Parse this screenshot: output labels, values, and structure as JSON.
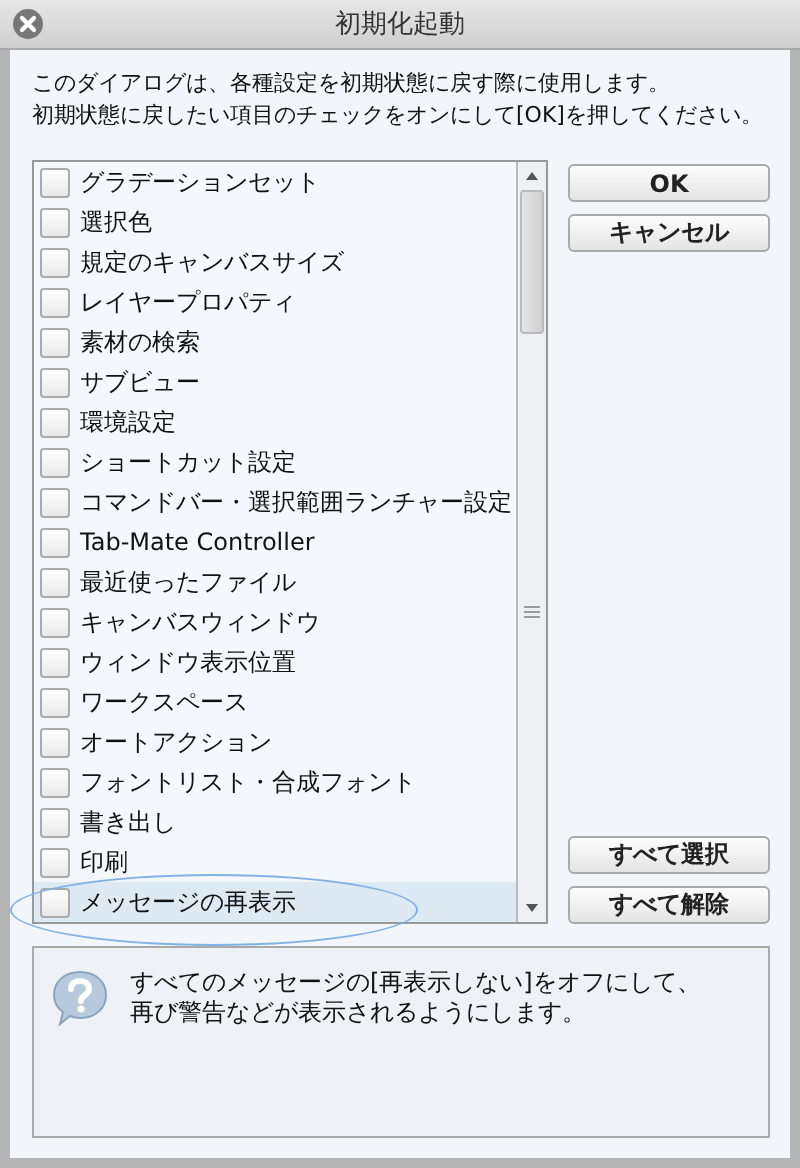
{
  "window": {
    "title": "初期化起動"
  },
  "description": [
    "このダイアログは、各種設定を初期状態に戻す際に使用します。",
    "初期状態に戻したい項目のチェックをオンにして[OK]を押してください。"
  ],
  "items": [
    {
      "label": "グラデーションセット",
      "checked": false,
      "selected": false
    },
    {
      "label": "選択色",
      "checked": false,
      "selected": false
    },
    {
      "label": "規定のキャンバスサイズ",
      "checked": false,
      "selected": false
    },
    {
      "label": "レイヤープロパティ",
      "checked": false,
      "selected": false
    },
    {
      "label": "素材の検索",
      "checked": false,
      "selected": false
    },
    {
      "label": "サブビュー",
      "checked": false,
      "selected": false
    },
    {
      "label": "環境設定",
      "checked": false,
      "selected": false
    },
    {
      "label": "ショートカット設定",
      "checked": false,
      "selected": false
    },
    {
      "label": "コマンドバー・選択範囲ランチャー設定",
      "checked": false,
      "selected": false
    },
    {
      "label": "Tab-Mate Controller",
      "checked": false,
      "selected": false
    },
    {
      "label": "最近使ったファイル",
      "checked": false,
      "selected": false
    },
    {
      "label": "キャンバスウィンドウ",
      "checked": false,
      "selected": false
    },
    {
      "label": "ウィンドウ表示位置",
      "checked": false,
      "selected": false
    },
    {
      "label": "ワークスペース",
      "checked": false,
      "selected": false
    },
    {
      "label": "オートアクション",
      "checked": false,
      "selected": false
    },
    {
      "label": "フォントリスト・合成フォント",
      "checked": false,
      "selected": false
    },
    {
      "label": "書き出し",
      "checked": false,
      "selected": false
    },
    {
      "label": "印刷",
      "checked": false,
      "selected": false
    },
    {
      "label": "メッセージの再表示",
      "checked": false,
      "selected": true
    }
  ],
  "buttons_top": [
    "OK",
    "キャンセル"
  ],
  "buttons_bottom": [
    "すべて選択",
    "すべて解除"
  ],
  "info": [
    "すべてのメッセージの[再表示しない]をオフにして、",
    "再び警告などが表示されるようにします。"
  ]
}
